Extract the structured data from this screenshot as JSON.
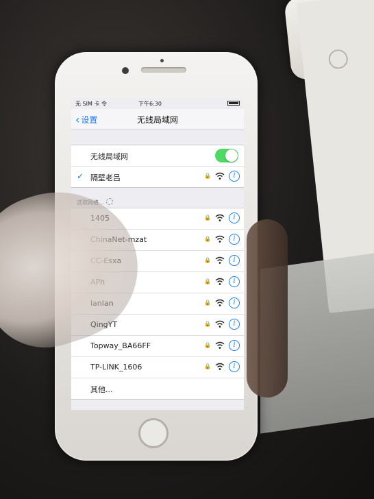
{
  "status_bar": {
    "carrier": "无 SIM 卡 令",
    "time": "下午6:30"
  },
  "nav": {
    "back_label": "设置",
    "title": "无线局域网"
  },
  "wifi_toggle": {
    "label": "无线局域网",
    "enabled": true
  },
  "connected_network": {
    "name": "隔壁老吕"
  },
  "section_header": "选取网络...",
  "networks": [
    {
      "name": "1405"
    },
    {
      "name": "ChinaNet-mzat"
    },
    {
      "name": "CC-Esxa"
    },
    {
      "name": "APh"
    },
    {
      "name": "lanlan"
    },
    {
      "name": "QingYT"
    },
    {
      "name": "Topway_BA66FF"
    },
    {
      "name": "TP-LINK_1606"
    }
  ],
  "other_label": "其他...",
  "colors": {
    "accent": "#1a7cf5",
    "toggle_on": "#4cd964"
  }
}
